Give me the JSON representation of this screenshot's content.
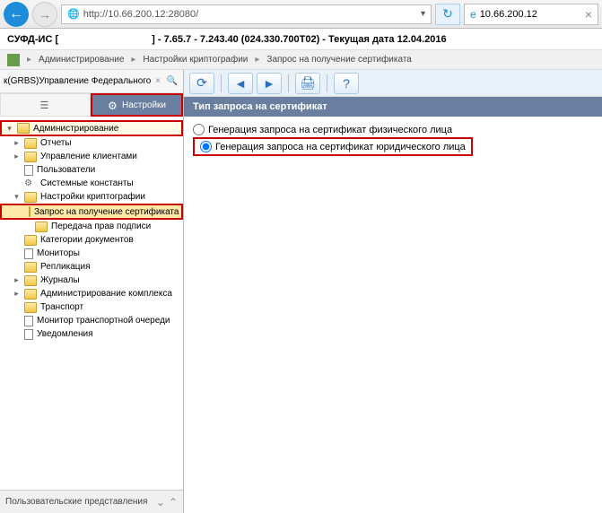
{
  "browser": {
    "address": "http://10.66.200.12:28080/",
    "tab_title": "10.66.200.12"
  },
  "app": {
    "title_left": "СУФД-ИС [",
    "title_right": "] - 7.65.7 - 7.243.40 (024.330.700T02) - Текущая дата 12.04.2016"
  },
  "breadcrumb": {
    "items": [
      "Администрирование",
      "Настройки криптографии",
      "Запрос на получение сертификата"
    ]
  },
  "sidebar": {
    "org": "к(GRBS)Управление Федерального казначейства",
    "tabs": {
      "menu": "Меню",
      "settings": "Настройки"
    },
    "tree": {
      "root": "Администрирование",
      "items": {
        "reports": "Отчеты",
        "clients": "Управление клиентами",
        "users": "Пользователи",
        "constants": "Системные константы",
        "crypto": "Настройки криптографии",
        "cert_request": "Запрос на получение сертификата",
        "transfer": "Передача прав подписи",
        "doc_cat": "Категории документов",
        "monitors": "Мониторы",
        "replication": "Репликация",
        "journals": "Журналы",
        "complex": "Администрирование комплекса",
        "transport": "Транспорт",
        "tqueue": "Монитор транспортной очереди",
        "notifications": "Уведомления"
      }
    },
    "bottom": "Пользовательские представления"
  },
  "content": {
    "section_title": "Тип запроса на сертификат",
    "radio1": "Генерация запроса на сертификат физического лица",
    "radio2": "Генерация запроса на сертификат юридического лица"
  }
}
